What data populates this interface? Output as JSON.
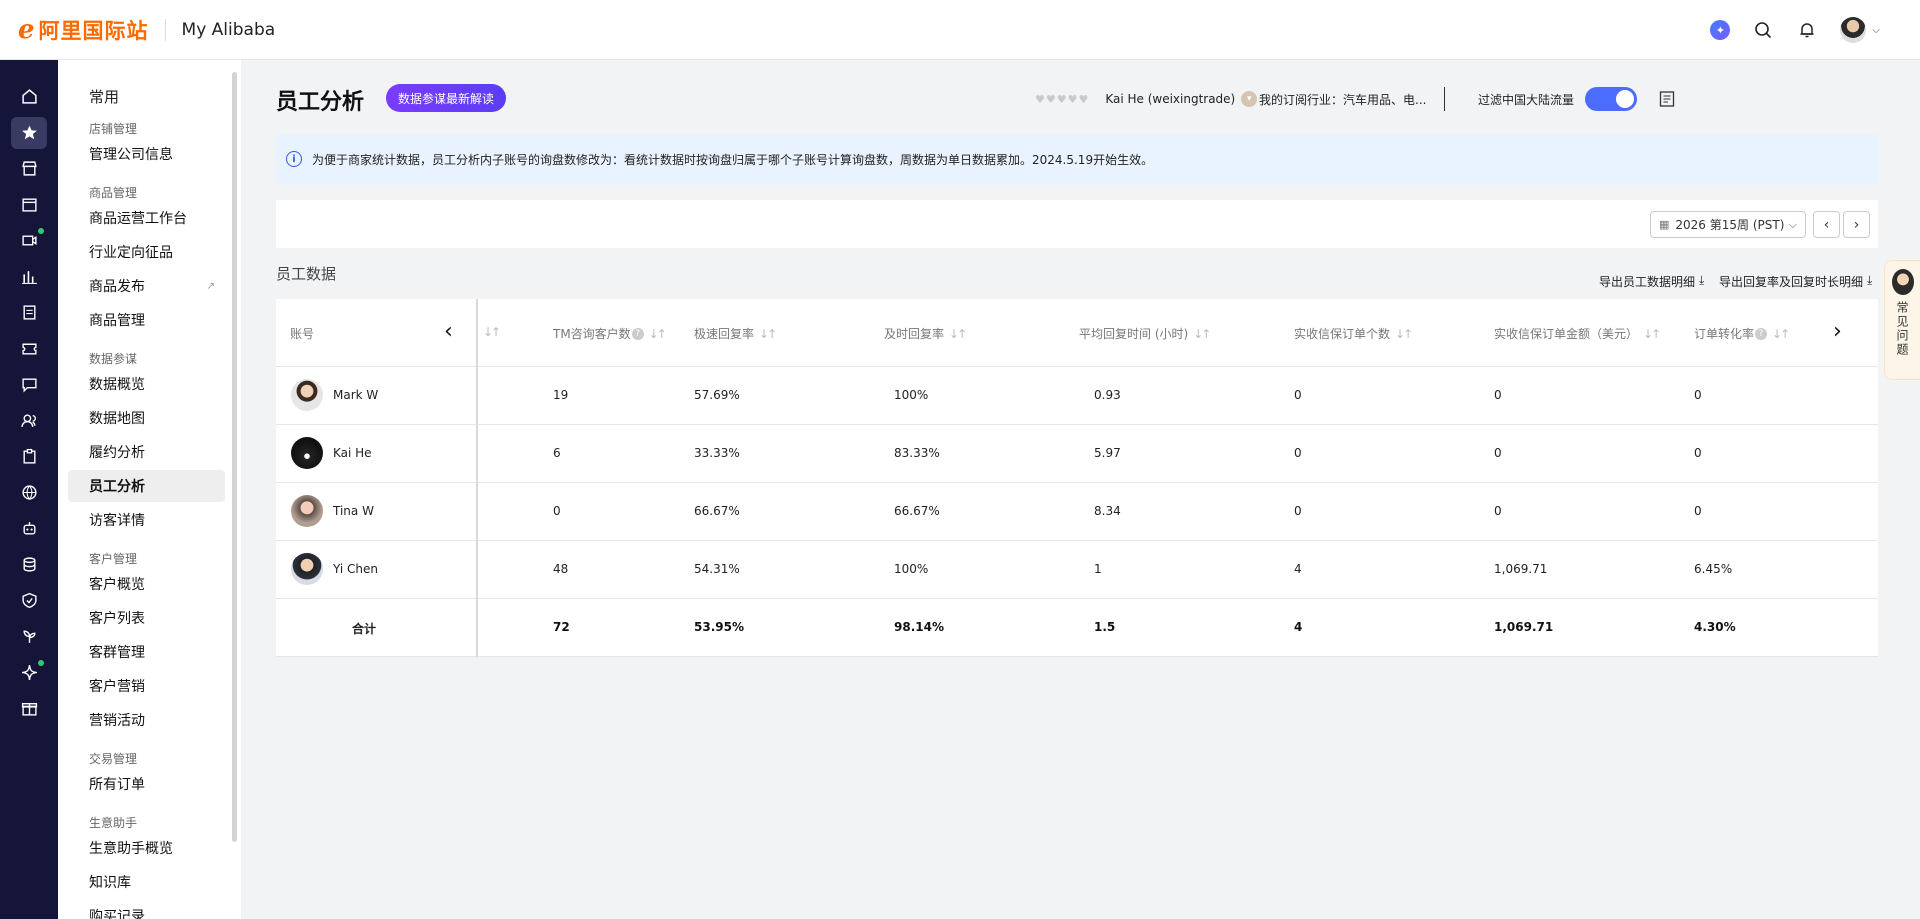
{
  "header": {
    "logo_text": "阿里国际站",
    "app_title": "My Alibaba",
    "ai_label": "✦"
  },
  "menu": {
    "sections": [
      {
        "type": "head",
        "label": "常用"
      },
      {
        "type": "group",
        "label": "店铺管理"
      },
      {
        "type": "item",
        "label": "管理公司信息"
      },
      {
        "type": "group",
        "label": "商品管理"
      },
      {
        "type": "item",
        "label": "商品运营工作台"
      },
      {
        "type": "item",
        "label": "行业定向征品"
      },
      {
        "type": "item",
        "label": "商品发布"
      },
      {
        "type": "item",
        "label": "商品管理"
      },
      {
        "type": "group",
        "label": "数据参谋"
      },
      {
        "type": "item",
        "label": "数据概览"
      },
      {
        "type": "item",
        "label": "数据地图"
      },
      {
        "type": "item",
        "label": "履约分析"
      },
      {
        "type": "item",
        "label": "员工分析"
      },
      {
        "type": "item",
        "label": "访客详情"
      },
      {
        "type": "group",
        "label": "客户管理"
      },
      {
        "type": "item",
        "label": "客户概览"
      },
      {
        "type": "item",
        "label": "客户列表"
      },
      {
        "type": "item",
        "label": "客群管理"
      },
      {
        "type": "item",
        "label": "客户营销"
      },
      {
        "type": "item",
        "label": "营销活动"
      },
      {
        "type": "group",
        "label": "交易管理"
      },
      {
        "type": "item",
        "label": "所有订单"
      },
      {
        "type": "group",
        "label": "生意助手"
      },
      {
        "type": "item",
        "label": "生意助手概览"
      },
      {
        "type": "item",
        "label": "知识库"
      },
      {
        "type": "item",
        "label": "购买记录"
      }
    ]
  },
  "page": {
    "title": "员工分析",
    "badge": "数据参谋最新解读",
    "stars": "♥♥♥♥♥",
    "account": "Kai He (weixingtrade)",
    "industry": "我的订阅行业：汽车用品、电...",
    "filter_label": "过滤中国大陆流量",
    "notice": "为便于商家统计数据，员工分析内子账号的询盘数修改为：看统计数据时按询盘归属于哪个子账号计算询盘数，周数据为单日数据累加。2024.5.19开始生效。",
    "date_value": "2026 第15周 (PST)",
    "section_title": "员工数据",
    "export_1": "导出员工数据明细",
    "export_2": "导出回复率及回复时长明细"
  },
  "table": {
    "col_account": "账号",
    "columns": [
      "TM咨询客户数",
      "极速回复率",
      "及时回复率",
      "平均回复时间 (小时)",
      "实收信保订单个数",
      "实收信保订单金额（美元）",
      "订单转化率"
    ],
    "rows": [
      {
        "name": "Mark W",
        "values": [
          "19",
          "57.69%",
          "100%",
          "0.93",
          "0",
          "0",
          "0"
        ]
      },
      {
        "name": "Kai He",
        "values": [
          "6",
          "33.33%",
          "83.33%",
          "5.97",
          "0",
          "0",
          "0"
        ]
      },
      {
        "name": "Tina W",
        "values": [
          "0",
          "66.67%",
          "66.67%",
          "8.34",
          "0",
          "0",
          "0"
        ]
      },
      {
        "name": "Yi Chen",
        "values": [
          "48",
          "54.31%",
          "100%",
          "1",
          "4",
          "1,069.71",
          "6.45%"
        ]
      }
    ],
    "total": {
      "name": "合计",
      "values": [
        "72",
        "53.95%",
        "98.14%",
        "1.5",
        "4",
        "1,069.71",
        "4.30%"
      ]
    }
  },
  "faq": {
    "label": "常见问题"
  },
  "colors": {
    "brand": "#ff6a00",
    "rail_bg": "#141538",
    "accent": "#4c6bff",
    "badge": "#6a3cff"
  }
}
